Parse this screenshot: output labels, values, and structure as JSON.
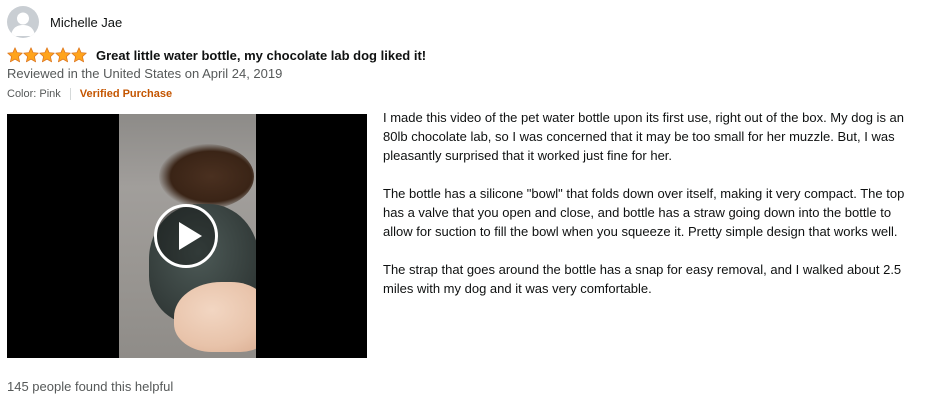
{
  "reviewer": {
    "name": "Michelle Jae",
    "avatar_icon": "person-silhouette-icon"
  },
  "rating": {
    "stars": 5,
    "max": 5,
    "star_color": "#ffa41c"
  },
  "review": {
    "title": "Great little water bottle, my chocolate lab dog liked it!",
    "date": "Reviewed in the United States on April 24, 2019",
    "color": "Color: Pink",
    "verified": "Verified Purchase",
    "paragraphs": [
      " I made this video of the pet water bottle upon its first use, right out of the box. My dog is an 80lb chocolate lab, so I was concerned that it may be too small for her muzzle. But, I was pleasantly surprised that it worked just fine for her.",
      "The bottle has a silicone \"bowl\" that folds down over itself, making it very compact. The top has a valve that you open and close, and bottle has a straw going down into the bottle to allow for suction to fill the bowl when you squeeze it. Pretty simple design that works well.",
      "The strap that goes around the bottle has a snap for easy removal, and I walked about 2.5 miles with my dog and it was very comfortable."
    ],
    "helpful": "145 people found this helpful"
  },
  "video": {
    "play_icon": "play-icon"
  },
  "colors": {
    "verified": "#c45500",
    "secondary_text": "#565959",
    "primary_text": "#0f1111"
  }
}
